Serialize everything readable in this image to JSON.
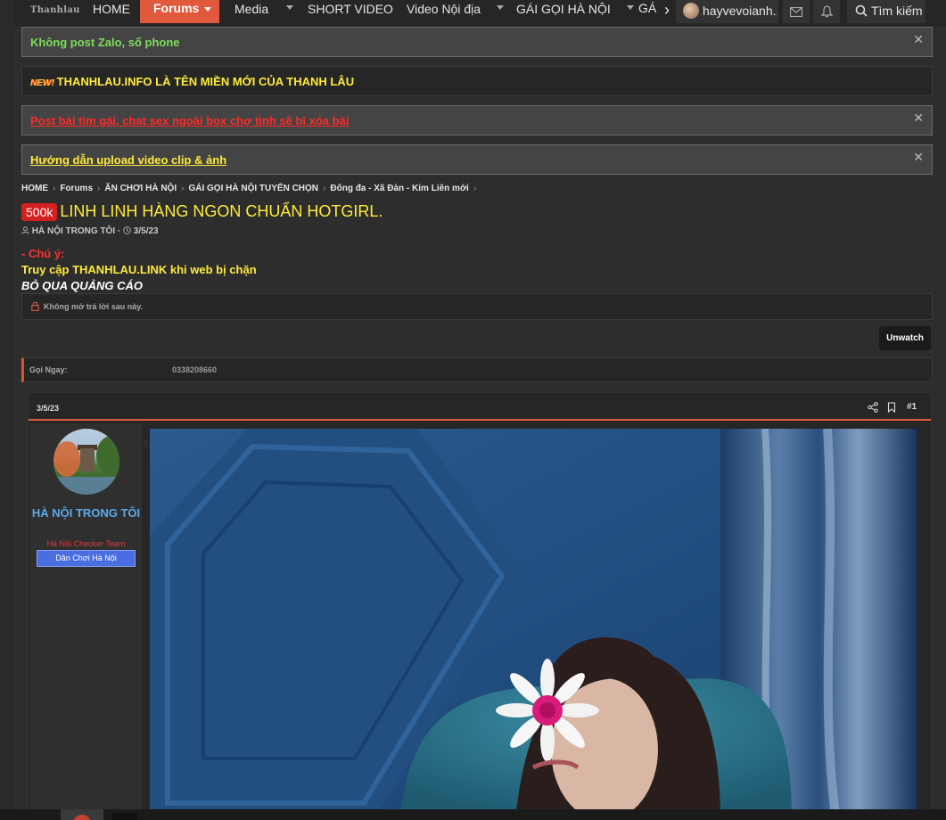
{
  "nav": {
    "logo": "Thanhlau",
    "items": [
      {
        "label": "HOME"
      },
      {
        "label": "Forums"
      },
      {
        "label": "Media"
      },
      {
        "label": "SHORT VIDEO"
      },
      {
        "label": "Video Nội địa"
      },
      {
        "label": "GÁI GỌI HÀ NỘI"
      },
      {
        "label": "GÁ"
      }
    ],
    "username": "hayvevoianh...",
    "search_label": "Tìm kiếm"
  },
  "notices": [
    {
      "text": "Không post Zalo, số phone",
      "color": "#7ddc5a",
      "closable": true
    },
    {
      "badge": "NEW!",
      "text": "THANHLAU.INFO LÀ TÊN MIỀN MỚI CỦA THANH LÂU",
      "color": "#ffeb3b",
      "closable": false
    },
    {
      "text": "Post bài tìm gái, chat sex ngoài box chợ tình sẽ bị xóa bài",
      "color": "#ff2a2a",
      "closable": true
    },
    {
      "text": "Hướng dẫn upload video clip & ảnh",
      "color": "#ffeb3b",
      "closable": true
    }
  ],
  "breadcrumb": [
    "HOME",
    "Forums",
    "ĂN CHƠI HÀ NỘI",
    "GÁI GỌI HÀ NỘI TUYỂN CHỌN",
    "Đống đa - Xã Đàn - Kim Liên mới"
  ],
  "thread": {
    "prefix": "500k",
    "title": "LINH LINH HÀNG NGON CHUẨN HOTGIRL.",
    "author": "HÀ NỘI TRONG TÔI",
    "date": "3/5/23"
  },
  "warnings": {
    "line1": "- Chú ý:",
    "line2": "Truy cập THANHLAU.LINK khi web bị chặn",
    "line3": "BỎ QUA QUẢNG CÁO"
  },
  "locked_text": "Không mở trả lời sau này.",
  "unwatch_label": "Unwatch",
  "field": {
    "label": "Gọi Ngay:",
    "value": "0338208660"
  },
  "post": {
    "date": "3/5/23",
    "number": "#1",
    "user": {
      "name": "HÀ NỘI TRONG TÔI",
      "title": "Hà Nội Checker Team",
      "banner": "Dân Chơi Hà Nội"
    }
  },
  "colors": {
    "accent": "#e0593d",
    "title": "#ffeb3b",
    "username": "#5aa8e6"
  }
}
